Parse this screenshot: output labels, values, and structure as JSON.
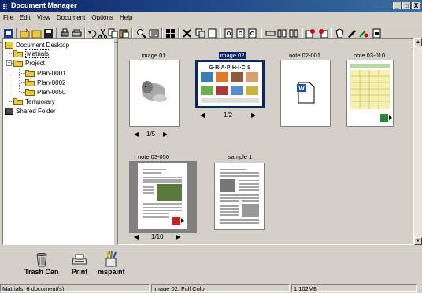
{
  "window": {
    "title": "Document Manager",
    "buttons": [
      "_",
      "□",
      "X"
    ]
  },
  "menubar": [
    "File",
    "Edit",
    "View",
    "Document",
    "Options",
    "Help"
  ],
  "tree": {
    "root": "Document Desktop",
    "items": [
      {
        "label": "Matrials",
        "selected": true
      },
      {
        "label": "Project"
      },
      {
        "label": "Plan-0001"
      },
      {
        "label": "Plan-0002"
      },
      {
        "label": "Plan-0050"
      },
      {
        "label": "Temporary"
      }
    ],
    "shared": "Shared Folder"
  },
  "documents": [
    {
      "name": "image 01",
      "pages": "1/5",
      "selected": false
    },
    {
      "name": "image 02",
      "pages": "1/2",
      "selected": true
    },
    {
      "name": "note 02-001",
      "pages": "",
      "selected": false
    },
    {
      "name": "note 03-010",
      "pages": "",
      "selected": false
    },
    {
      "name": "note 03-050",
      "pages": "1/10",
      "selected": false
    },
    {
      "name": "sample 1",
      "pages": "",
      "selected": false
    }
  ],
  "thumbnail_text": {
    "graphics": "G·R·A·P·H·I·C·S"
  },
  "bottom_tools": [
    {
      "label": "Trash Can",
      "icon": "trash-can-icon"
    },
    {
      "label": "Print",
      "icon": "printer-icon"
    },
    {
      "label": "mspaint",
      "icon": "paint-icon"
    }
  ],
  "status": {
    "folder": "Matrials, 6 document(s)",
    "selection": "image 02, Full Color",
    "size": "1.102MB"
  },
  "colors": {
    "title_bar": "#0a246a",
    "selection": "#0a246a",
    "face": "#d4d0c8"
  }
}
